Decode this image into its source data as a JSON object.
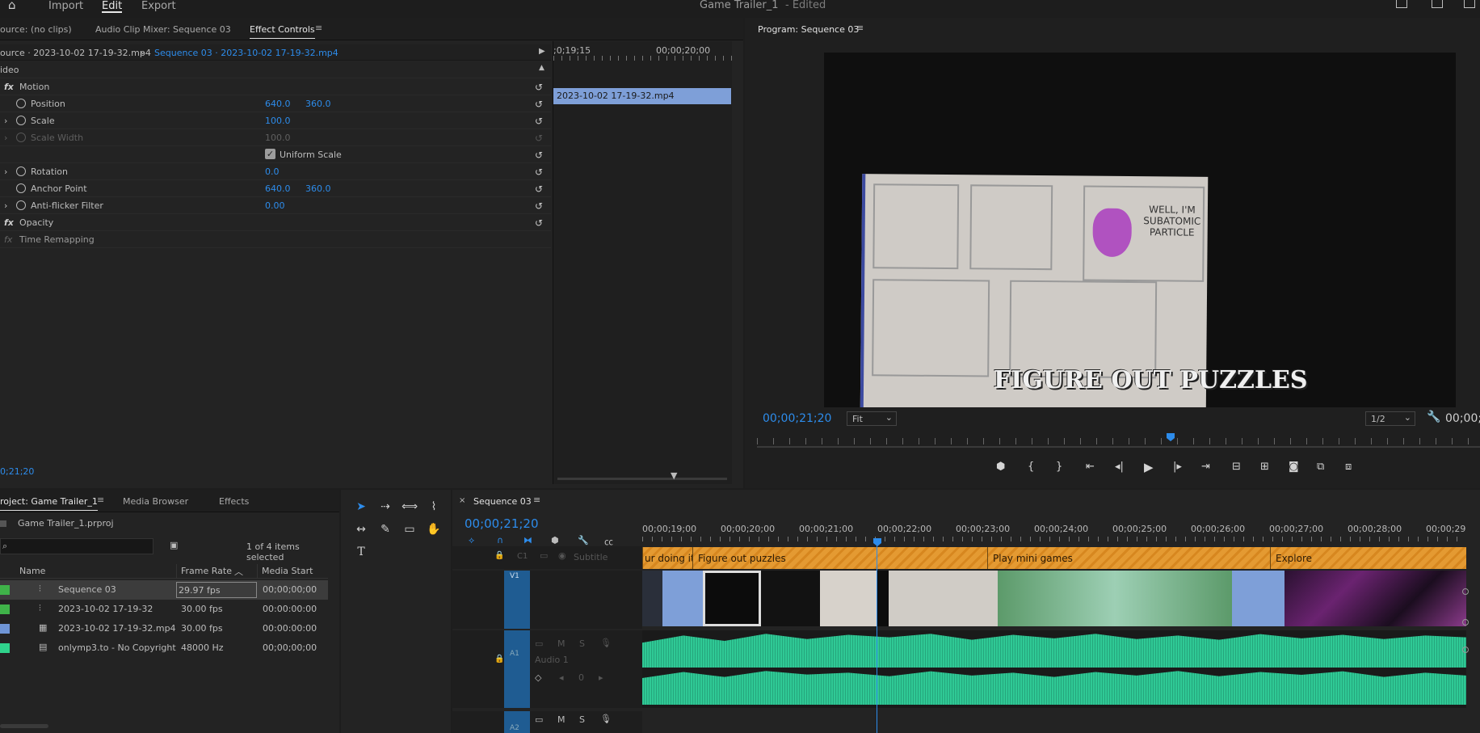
{
  "topbar": {
    "home": "home-icon",
    "import": "Import",
    "edit": "Edit",
    "export": "Export",
    "title": "Game Trailer_1",
    "edited": "- Edited"
  },
  "source_tabs": {
    "source": "ource: (no clips)",
    "mixer": "Audio Clip Mixer: Sequence 03",
    "effect_controls": "Effect Controls"
  },
  "ec": {
    "master": "ource · 2023-10-02 17-19-32.mp4",
    "sequence_clip": "Sequence 03 · 2023-10-02 17-19-32.mp4",
    "ruler_a": ";0;19;15",
    "ruler_b": "00;00;20;00",
    "clip_name": "2023-10-02 17-19-32.mp4",
    "video": "ideo",
    "motion": "Motion",
    "position": "Position",
    "pos_x": "640.0",
    "pos_y": "360.0",
    "scale": "Scale",
    "scale_v": "100.0",
    "scale_width": "Scale Width",
    "scale_width_v": "100.0",
    "uniform": "Uniform Scale",
    "rotation": "Rotation",
    "rotation_v": "0.0",
    "anchor": "Anchor Point",
    "anchor_x": "640.0",
    "anchor_y": "360.0",
    "antiflicker": "Anti-flicker Filter",
    "antiflicker_v": "0.00",
    "opacity": "Opacity",
    "time_remap": "Time Remapping",
    "timecode": "0;21;20",
    "fx": "fx"
  },
  "program": {
    "title": "Program: Sequence 03",
    "timecode": "00;00;21;20",
    "fit": "Fit",
    "res": "1/2",
    "dur": "00;00;",
    "caption": "FIGURE OUT PUZZLES",
    "speech": "WELL, I'M SUBATOMIC PARTICLE"
  },
  "project": {
    "tab": "roject: Game Trailer_1",
    "media": "Media Browser",
    "effects": "Effects",
    "file": "Game Trailer_1.prproj",
    "selected": "1 of 4 items selected",
    "col_name": "Name",
    "col_fps": "Frame Rate",
    "col_start": "Media Start",
    "items": [
      {
        "name": "Sequence 03",
        "fps": "29.97 fps",
        "start": "00;00;00;00",
        "color": "#3fb349"
      },
      {
        "name": "2023-10-02 17-19-32",
        "fps": "30.00 fps",
        "start": "00:00:00:00",
        "color": "#3fb349"
      },
      {
        "name": "2023-10-02 17-19-32.mp4",
        "fps": "30.00 fps",
        "start": "00:00:00:00",
        "color": "#6f95d6"
      },
      {
        "name": "onlymp3.to -  No Copyright",
        "fps": "48000 Hz",
        "start": "00;00;00;00",
        "color": "#2fd38c"
      }
    ]
  },
  "timeline": {
    "title": "Sequence 03",
    "timecode": "00;00;21;20",
    "ruler": [
      "00;00;19;00",
      "00;00;20;00",
      "00;00;21;00",
      "00;00;22;00",
      "00;00;23;00",
      "00;00;24;00",
      "00;00;25;00",
      "00;00;26;00",
      "00;00;27;00",
      "00;00;28;00",
      "00;00;29"
    ],
    "subtitle": "Subtitle",
    "v1": "V1",
    "a1": "A1",
    "a2": "A2",
    "audio1": "Audio 1",
    "c1": "C1",
    "markers": [
      "ur doing it",
      "Figure out puzzles",
      "Play mini games",
      "Explore"
    ],
    "m": "M",
    "s": "S",
    "zero": "0"
  }
}
